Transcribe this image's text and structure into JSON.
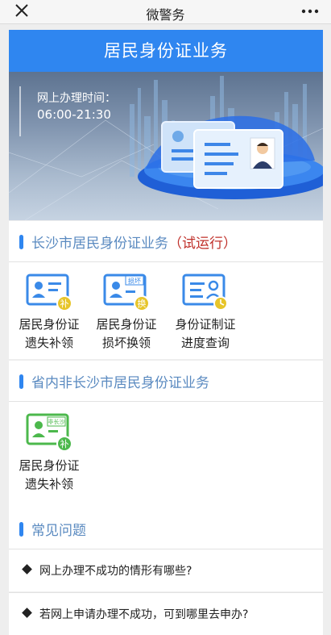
{
  "nav": {
    "title": "微警务",
    "more_label": "•••"
  },
  "header": {
    "title": "居民身份证业务"
  },
  "banner": {
    "hours_label": "网上办理时间：",
    "hours_value": "06:00-21:30"
  },
  "changsha": {
    "title": "长沙市居民身份证业务",
    "tag": "（试运行）",
    "tiles": [
      {
        "line1": "居民身份证",
        "line2": "遗失补领",
        "badge": "补"
      },
      {
        "line1": "居民身份证",
        "line2": "损坏换领",
        "badge": "换",
        "top_tag": "损坏"
      },
      {
        "line1": "身份证制证",
        "line2": "进度查询"
      }
    ]
  },
  "province": {
    "title": "省内非长沙市居民身份证业务",
    "tiles": [
      {
        "line1": "居民身份证",
        "line2": "遗失补领",
        "badge": "补",
        "top_tag": "非长沙"
      }
    ]
  },
  "faq": {
    "title": "常见问题",
    "items": [
      "网上办理不成功的情形有哪些?",
      "若网上申请办理不成功，可到哪里去申办?"
    ]
  },
  "colors": {
    "primary": "#2f86f0",
    "section_text": "#5a8ac0",
    "tag_red": "#c0312b",
    "green": "#4cb84c",
    "badge_yellow": "#e7c52a"
  }
}
